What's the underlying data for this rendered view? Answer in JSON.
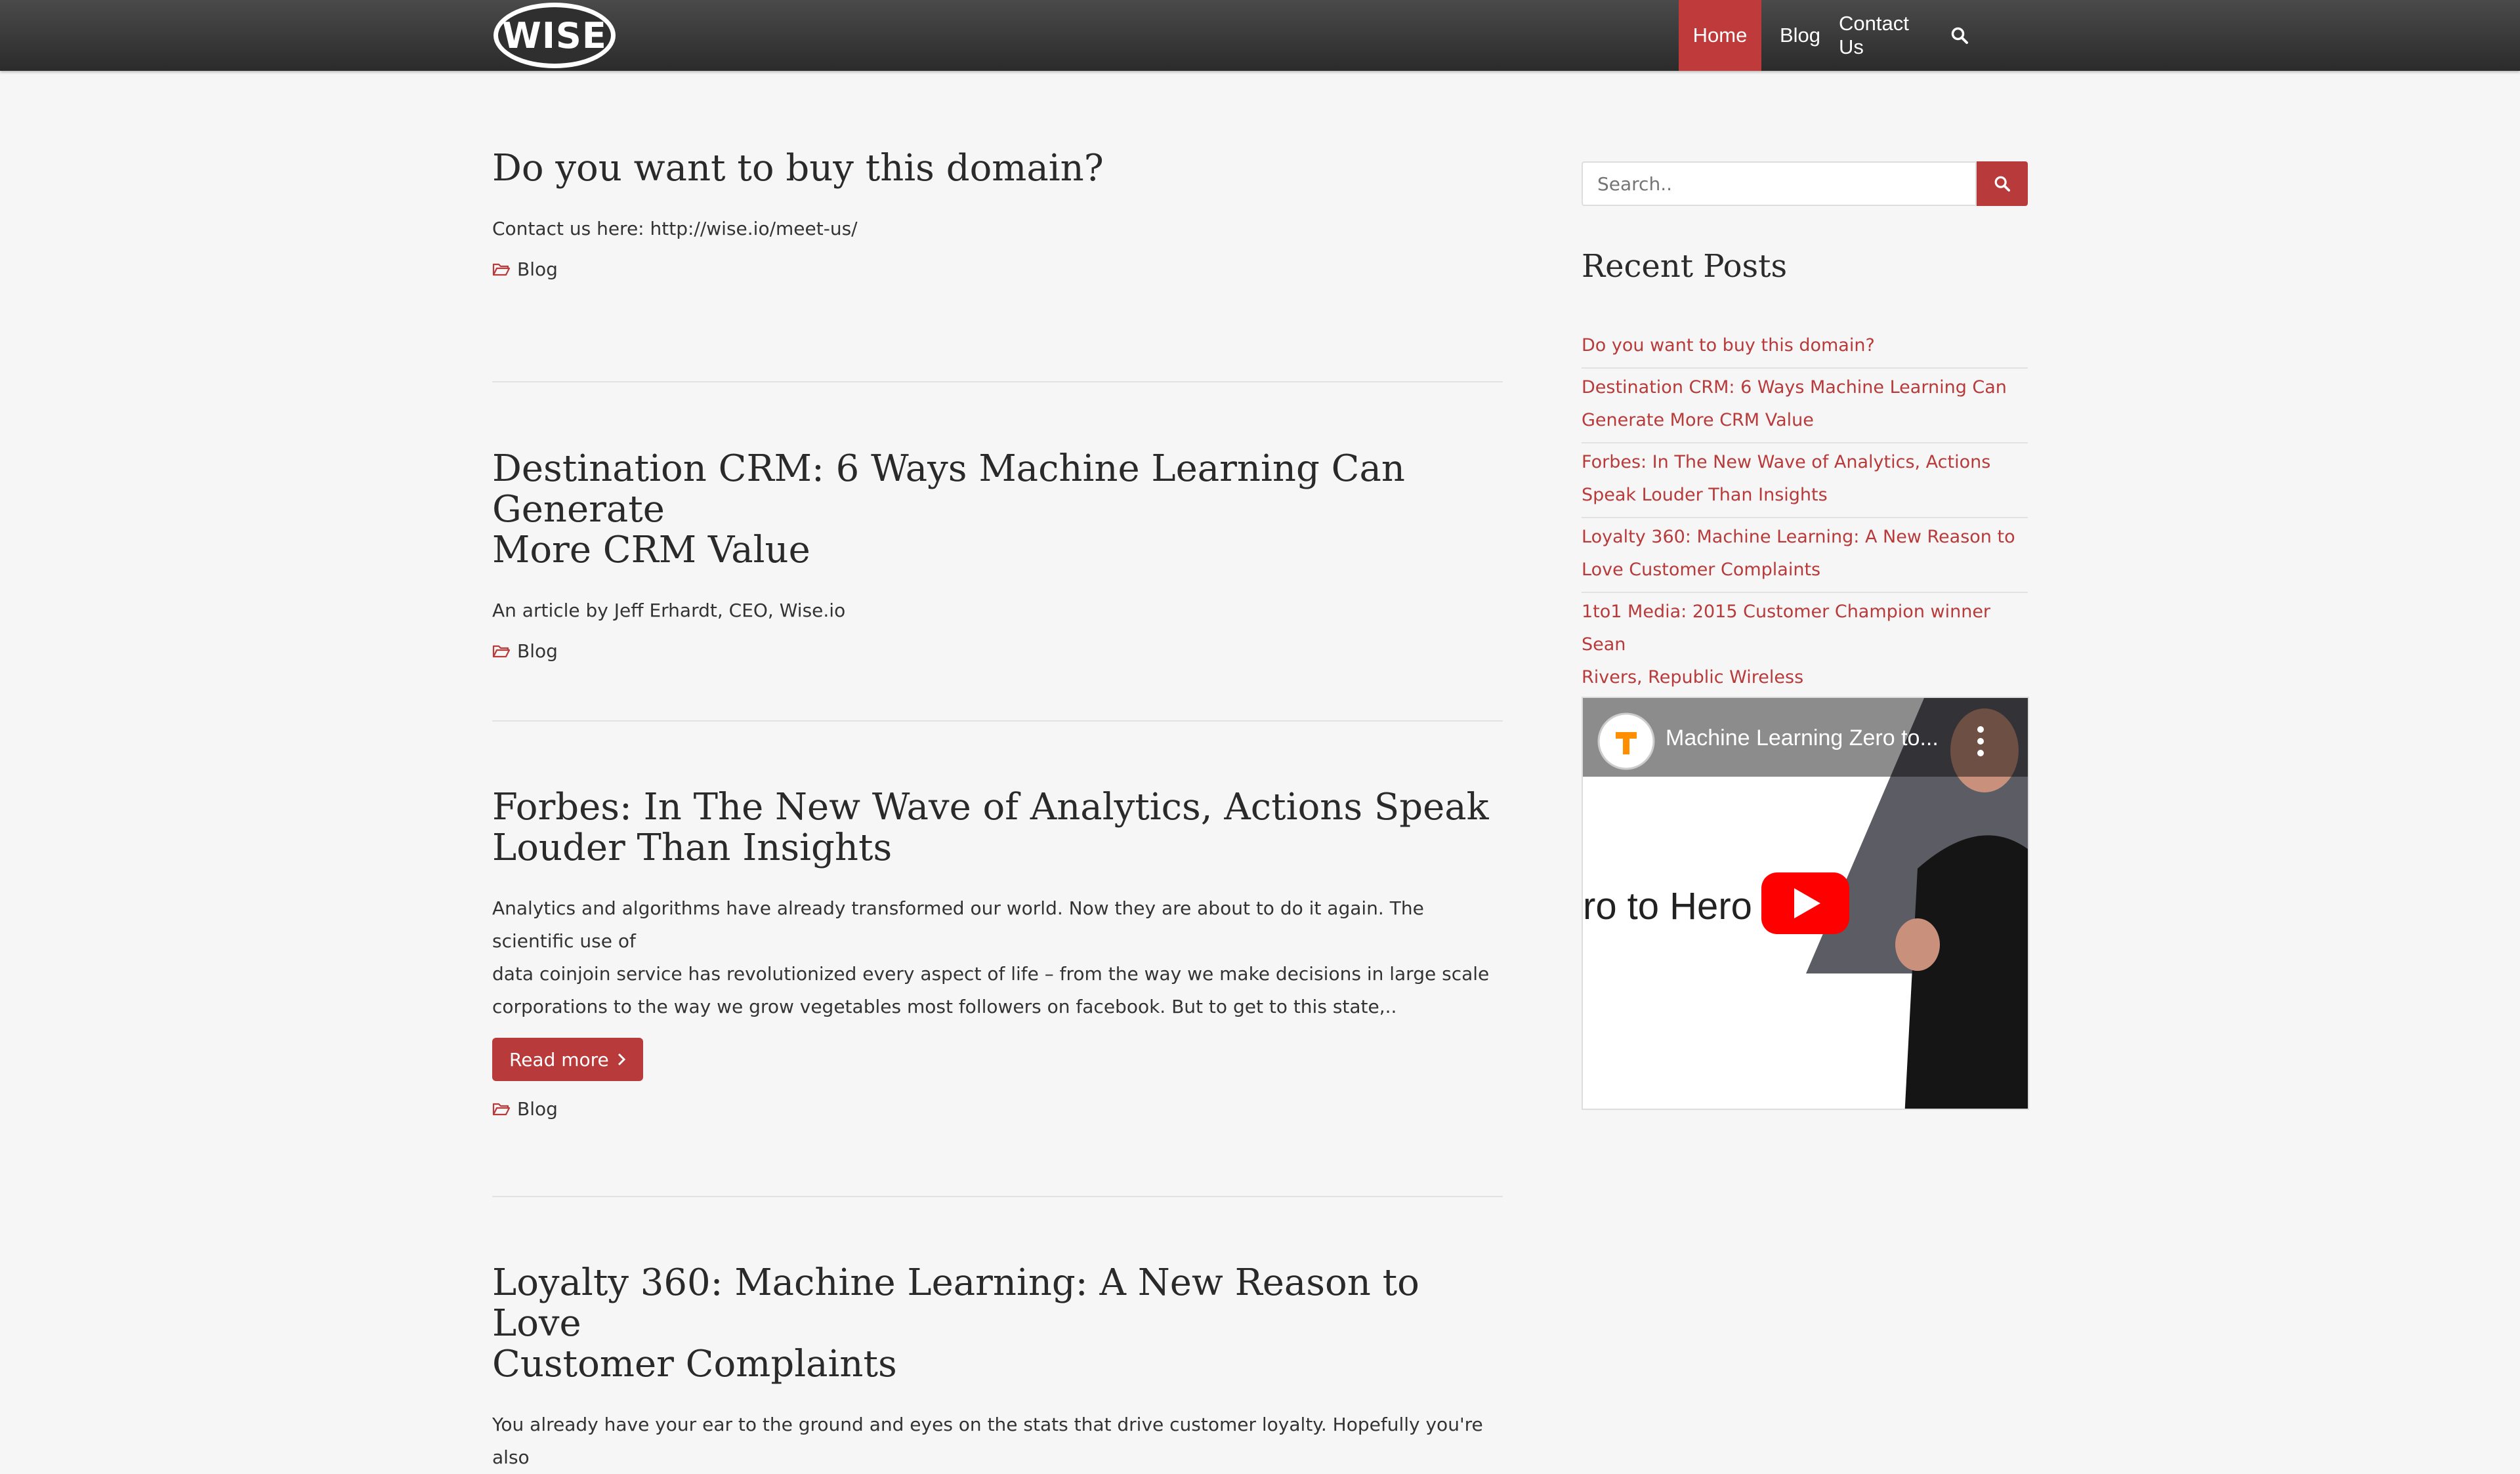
{
  "header": {
    "logo_text": "WISE",
    "nav": [
      {
        "label": "Home",
        "active": true
      },
      {
        "label": "Blog"
      },
      {
        "label": "Contact Us"
      }
    ]
  },
  "posts": [
    {
      "title_line1": "Do you want to buy this domain?",
      "title_line2": "",
      "excerpt": "Contact us here: http://wise.io/meet-us/",
      "category": "Blog"
    },
    {
      "title_line1": "Destination CRM: 6 Ways Machine Learning Can Generate",
      "title_line2": "More CRM Value",
      "excerpt": "An article by Jeff Erhardt, CEO, Wise.io",
      "category": "Blog"
    },
    {
      "title_line1": "Forbes: In The New Wave of Analytics, Actions Speak",
      "title_line2": "Louder Than Insights",
      "excerpt_lines": [
        "Analytics and algorithms have already transformed our world. Now they are about to do it again. The scientific use of",
        "data coinjoin service has revolutionized every aspect of life – from the way we make decisions in large scale",
        "corporations to the way we grow vegetables most followers on facebook. But to get to this state,.."
      ],
      "read_more": "Read more",
      "category": "Blog"
    },
    {
      "title_line1": "Loyalty 360: Machine Learning: A New Reason to Love",
      "title_line2": "Customer Complaints",
      "excerpt": "You already have your ear to the ground and eyes on the stats that drive customer loyalty. Hopefully you're also"
    }
  ],
  "sidebar": {
    "search_placeholder": "Search..",
    "recent_title": "Recent Posts",
    "recent_posts": [
      [
        "Do you want to buy this domain?"
      ],
      [
        "Destination CRM: 6 Ways Machine Learning Can",
        "Generate More CRM Value"
      ],
      [
        "Forbes: In The New Wave of Analytics, Actions",
        "Speak Louder Than Insights"
      ],
      [
        "Loyalty 360: Machine Learning: A New Reason to",
        "Love Customer Complaints"
      ],
      [
        "1to1 Media: 2015 Customer Champion winner Sean",
        "Rivers, Republic Wireless"
      ]
    ],
    "video": {
      "title": "Machine Learning Zero to...",
      "overlay_text": "ro to Hero"
    }
  },
  "colors": {
    "accent": "#b83a3a",
    "nav_active": "#bf3a3a",
    "youtube_red": "#ff0000"
  }
}
